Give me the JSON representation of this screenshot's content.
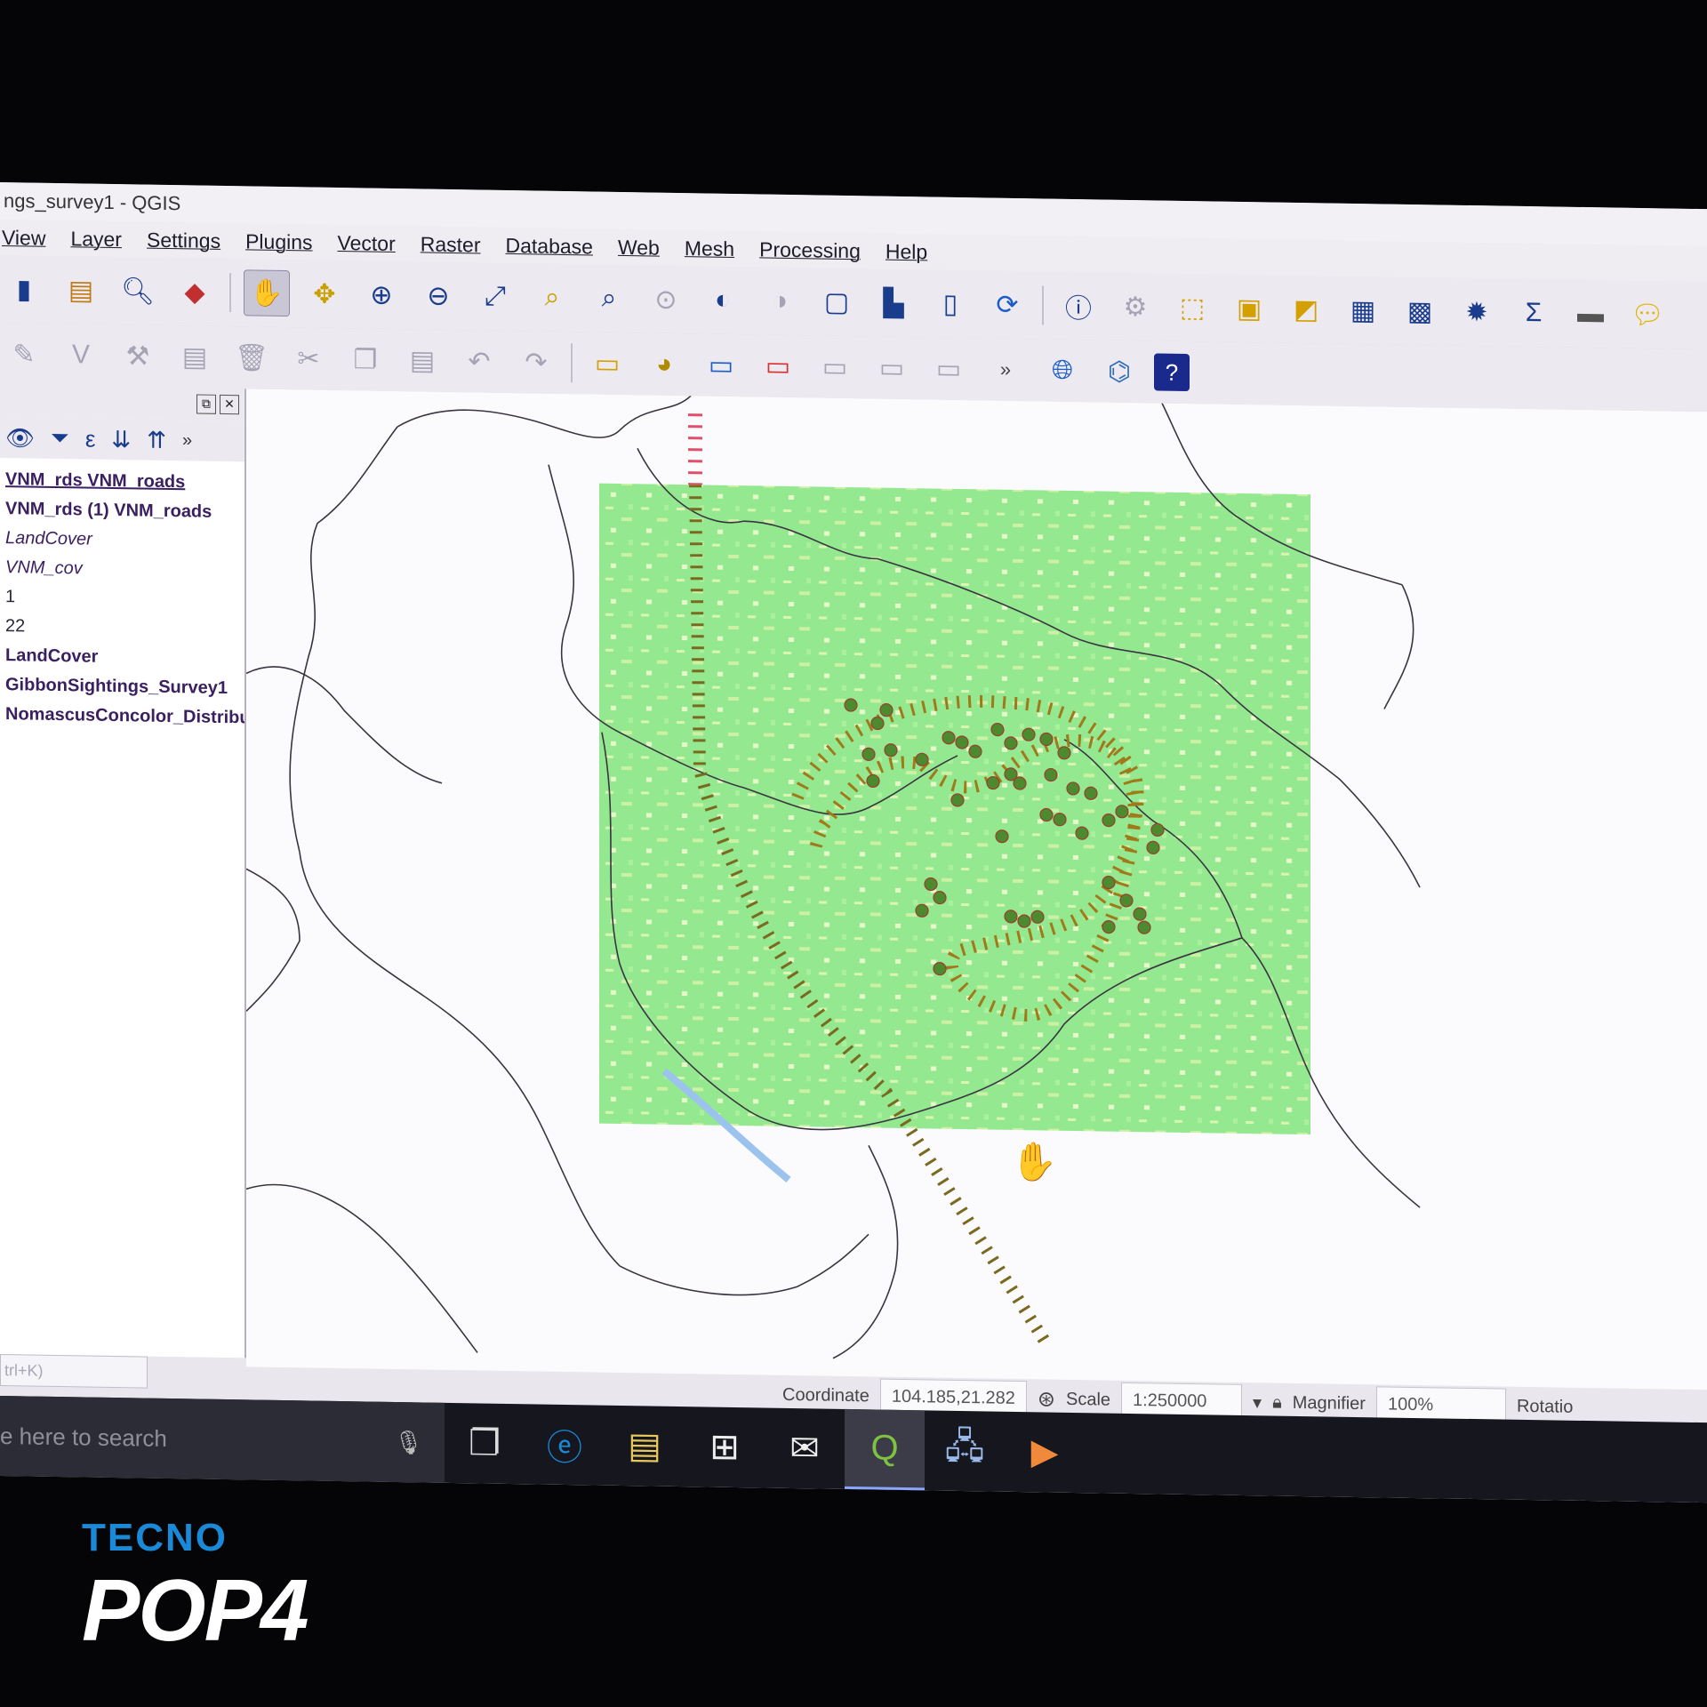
{
  "window": {
    "title": "ngs_survey1 - QGIS"
  },
  "menu": [
    "View",
    "Layer",
    "Settings",
    "Plugins",
    "Vector",
    "Raster",
    "Database",
    "Web",
    "Mesh",
    "Processing",
    "Help"
  ],
  "toolbar1": {
    "icons": [
      "save-project-icon",
      "new-print-layout-icon",
      "layout-manager-icon",
      "style-manager-icon",
      "pan-icon",
      "pan-to-selection-icon",
      "zoom-in-icon",
      "zoom-out-icon",
      "zoom-full-icon",
      "zoom-to-selection-icon",
      "zoom-to-layer-icon",
      "zoom-native-icon",
      "zoom-last-icon",
      "zoom-next-icon",
      "new-map-view-icon",
      "new-bookmark-icon",
      "show-bookmarks-icon",
      "refresh-icon",
      "identify-icon",
      "run-action-icon",
      "select-features-icon",
      "open-attribute-table-icon",
      "deselect-icon",
      "attribute-table-icon",
      "field-calculator-icon",
      "processing-toolbox-icon",
      "statistics-icon",
      "measure-icon",
      "map-tips-icon"
    ]
  },
  "toolbar2": {
    "icons": [
      "toggle-editing-icon",
      "add-feature-icon",
      "vertex-tool-icon",
      "modify-attributes-icon",
      "delete-selected-icon",
      "cut-features-icon",
      "copy-features-icon",
      "paste-features-icon",
      "undo-icon",
      "redo-icon",
      "label-tool-icon",
      "diagram-tool-icon",
      "pin-labels-icon",
      "highlight-pinned-labels-icon",
      "move-label-icon",
      "rotate-label-icon",
      "change-label-icon",
      "more-tools-icon",
      "web-globe-icon",
      "python-console-icon",
      "help-icon"
    ]
  },
  "layers": {
    "panel_tools": [
      "eye-icon",
      "filter-icon",
      "expression-filter-icon",
      "expand-all-icon",
      "collapse-all-icon",
      "more-icon"
    ],
    "items": [
      {
        "label": "VNM_rds VNM_roads",
        "style": "bold u"
      },
      {
        "label": "VNM_rds (1) VNM_roads",
        "style": "bold"
      },
      {
        "label": "LandCover",
        "style": "italic"
      },
      {
        "label": "VNM_cov",
        "style": "italic"
      },
      {
        "label": "1",
        "style": "plain"
      },
      {
        "label": "22",
        "style": "plain"
      },
      {
        "label": "LandCover",
        "style": "bold"
      },
      {
        "label": "GibbonSightings_Survey1",
        "style": "bold"
      },
      {
        "label": "NomascusConcolor_Distribution",
        "style": "bold"
      }
    ],
    "locator_placeholder": "trl+K)"
  },
  "status": {
    "coordinate_label": "Coordinate",
    "coordinate_value": "104.185,21.282",
    "scale_label": "Scale",
    "scale_value": "1:250000",
    "magnifier_label": "Magnifier",
    "magnifier_value": "100%",
    "rotation_label": "Rotatio"
  },
  "taskbar": {
    "search_placeholder": "e here to search",
    "icons": [
      "microphone-icon",
      "task-view-icon",
      "edge-icon",
      "file-explorer-icon",
      "store-icon",
      "mail-icon",
      "qgis-icon",
      "network-icon",
      "media-player-icon"
    ]
  },
  "watermark": {
    "brand": "TECNO",
    "model": "POP4"
  },
  "colors": {
    "landcover": "#8fe88a",
    "landcover_light": "#d8f5b0",
    "river": "#9bc3ee",
    "boundary": "#3a3340",
    "sightings": "#4d8a2e",
    "range_dash": "#a07a1a",
    "road_dash": "#e0506a"
  }
}
